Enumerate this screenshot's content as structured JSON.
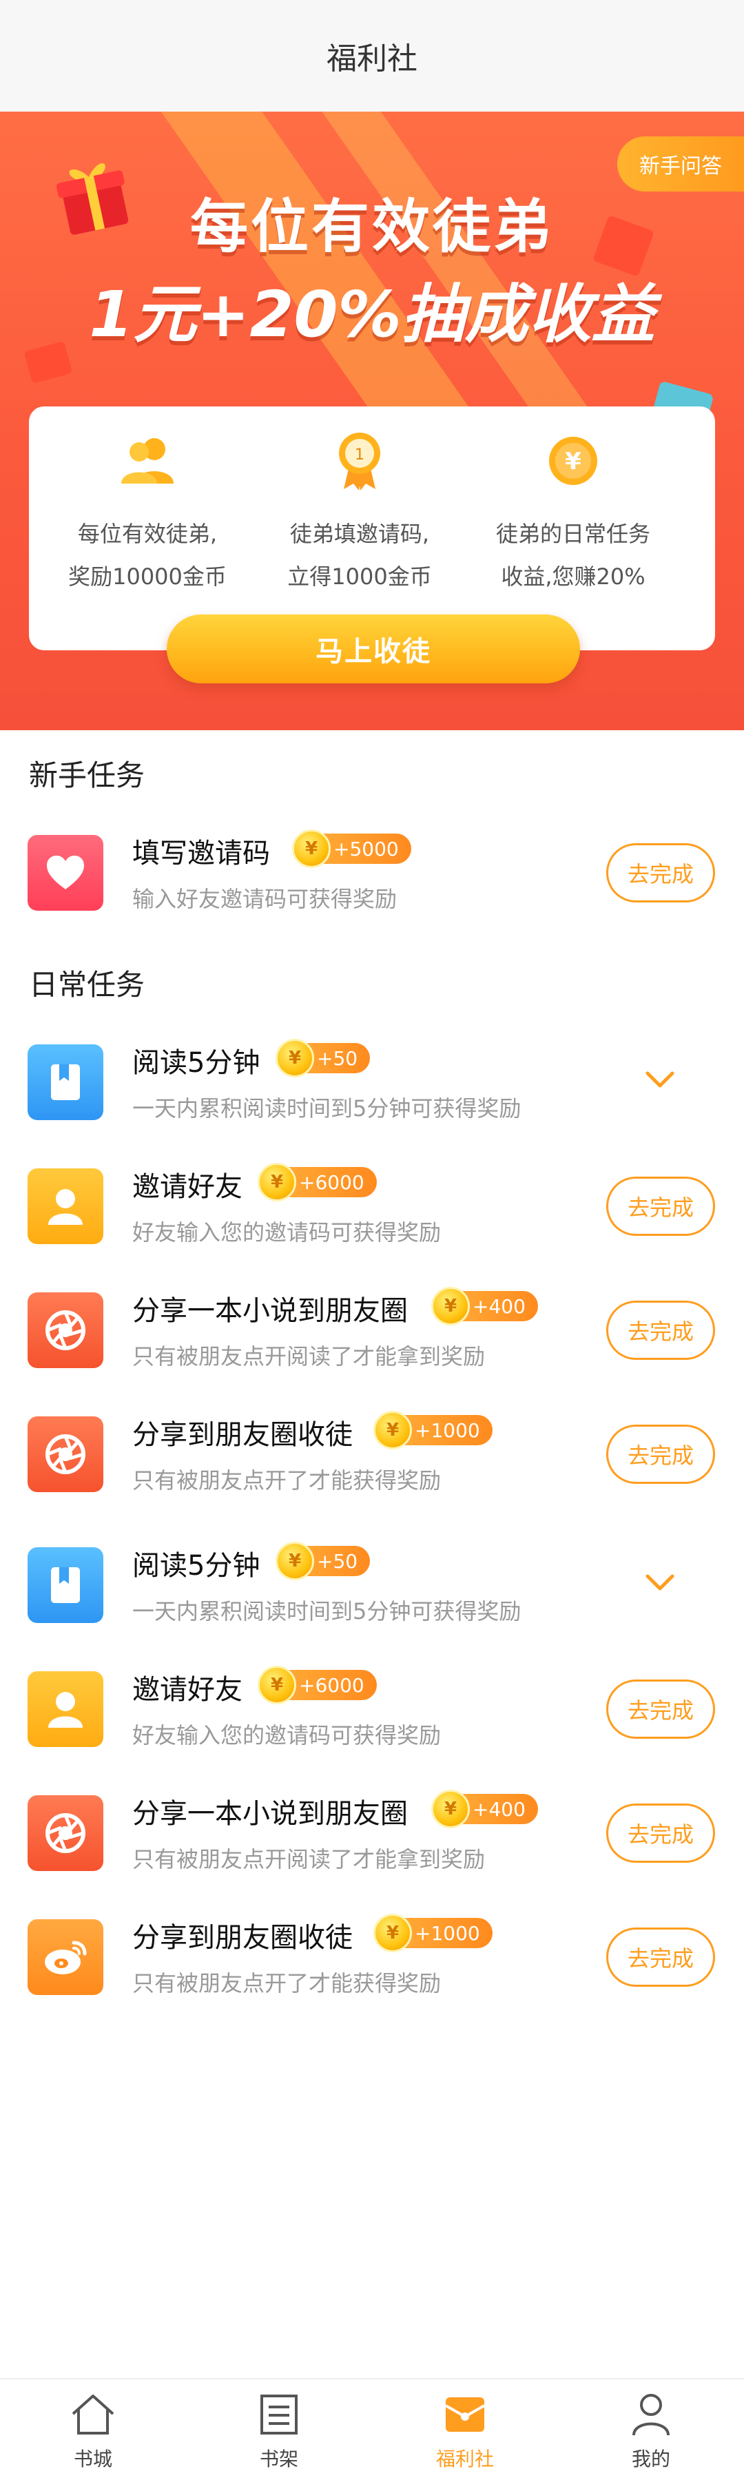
{
  "header": {
    "title": "福利社"
  },
  "hero": {
    "faq_label": "新手问答",
    "headline_line1": "每位有效徒弟",
    "headline_line2": "1元+20%抽成收益",
    "features": [
      {
        "icon": "users-icon",
        "line1": "每位有效徒弟,",
        "line2": "奖励10000金币"
      },
      {
        "icon": "medal-icon",
        "line1": "徒弟填邀请码,",
        "line2": "立得1000金币"
      },
      {
        "icon": "yuan-coin-icon",
        "line1": "徒弟的日常任务",
        "line2": "收益,您赚20%"
      }
    ],
    "cta_label": "马上收徒",
    "medal_text": "1"
  },
  "coin_symbol": "¥",
  "newbie": {
    "title": "新手任务",
    "tasks": [
      {
        "icon": "heart-icon",
        "name": "填写邀请码",
        "reward": "+5000",
        "desc": "输入好友邀请码可获得奖励",
        "button": "去完成"
      }
    ]
  },
  "daily": {
    "title": "日常任务",
    "tasks": [
      {
        "icon": "book-icon",
        "name": "阅读5分钟",
        "reward": "+50",
        "desc": "一天内累积阅读时间到5分钟可获得奖励",
        "button": ""
      },
      {
        "icon": "person-icon",
        "name": "邀请好友",
        "reward": "+6000",
        "desc": "好友输入您的邀请码可获得奖励",
        "button": "去完成"
      },
      {
        "icon": "aperture-icon",
        "name": "分享一本小说到朋友圈",
        "reward": "+400",
        "desc": "只有被朋友点开阅读了才能拿到奖励",
        "button": "去完成"
      },
      {
        "icon": "aperture-icon",
        "name": "分享到朋友圈收徒",
        "reward": "+1000",
        "desc": "只有被朋友点开了才能获得奖励",
        "button": "去完成"
      },
      {
        "icon": "book-icon",
        "name": "阅读5分钟",
        "reward": "+50",
        "desc": "一天内累积阅读时间到5分钟可获得奖励",
        "button": ""
      },
      {
        "icon": "person-icon",
        "name": "邀请好友",
        "reward": "+6000",
        "desc": "好友输入您的邀请码可获得奖励",
        "button": "去完成"
      },
      {
        "icon": "aperture-icon",
        "name": "分享一本小说到朋友圈",
        "reward": "+400",
        "desc": "只有被朋友点开阅读了才能拿到奖励",
        "button": "去完成"
      },
      {
        "icon": "weibo-icon",
        "name": "分享到朋友圈收徒",
        "reward": "+1000",
        "desc": "只有被朋友点开了才能获得奖励",
        "button": "去完成"
      }
    ]
  },
  "nav": {
    "items": [
      {
        "icon": "home-icon",
        "label": "书城"
      },
      {
        "icon": "bookshelf-icon",
        "label": "书架"
      },
      {
        "icon": "gift-envelope-icon",
        "label": "福利社",
        "active": true
      },
      {
        "icon": "profile-icon",
        "label": "我的"
      }
    ]
  },
  "colors": {
    "accent": "#ff9d1e",
    "hero": "#fb5a3c",
    "text_muted": "#999999"
  }
}
